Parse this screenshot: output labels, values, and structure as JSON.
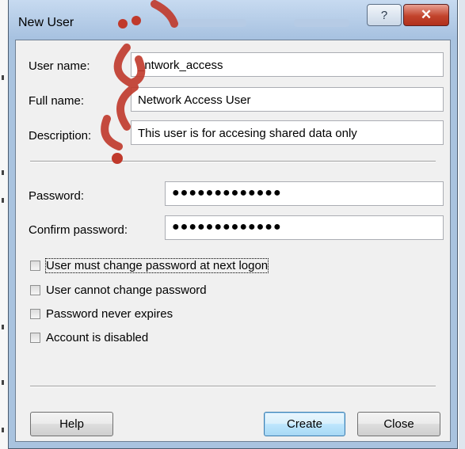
{
  "window": {
    "title": "New User",
    "help_glyph": "?",
    "close_glyph": "✕"
  },
  "form": {
    "username": {
      "label": "User name:",
      "value": "_ntwork_access"
    },
    "fullname": {
      "label": "Full name:",
      "value": "Network Access User"
    },
    "description": {
      "label": "Description:",
      "value": "This user is for accesing shared data only"
    },
    "password": {
      "label": "Password:",
      "value": "●●●●●●●●●●●●●"
    },
    "confirm": {
      "label": "Confirm password:",
      "value": "●●●●●●●●●●●●●"
    }
  },
  "options": [
    {
      "label": "User must change password at next logon",
      "checked": false
    },
    {
      "label": "User cannot change password",
      "checked": false
    },
    {
      "label": "Password never expires",
      "checked": false
    },
    {
      "label": "Account is disabled",
      "checked": false
    }
  ],
  "buttons": {
    "help": "Help",
    "create": "Create",
    "close": "Close"
  },
  "colors": {
    "frame": "#a9c3df",
    "client": "#f0f0f0",
    "close_button": "#c2432c"
  },
  "icons": [
    "help-icon",
    "close-icon",
    "watermark-logo"
  ]
}
